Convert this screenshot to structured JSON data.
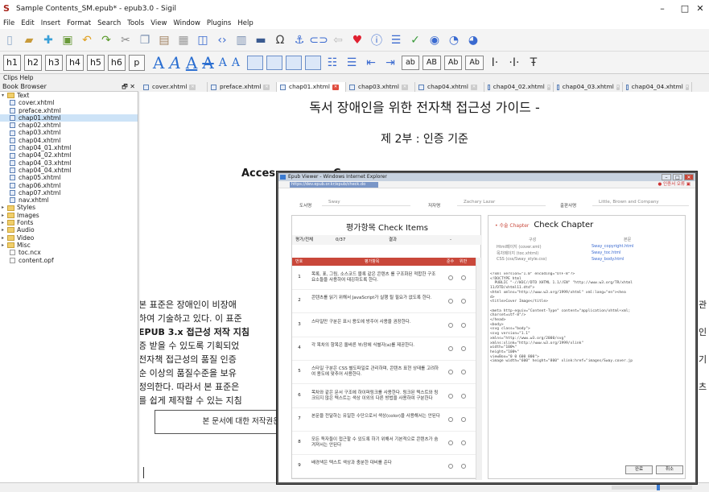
{
  "window": {
    "title": "Sample Contents_SM.epub* - epub3.0 - Sigil",
    "app_icon": "S",
    "minimize": "–",
    "maximize": "□",
    "close": "✕"
  },
  "menu": [
    "File",
    "Edit",
    "Insert",
    "Format",
    "Search",
    "Tools",
    "View",
    "Window",
    "Plugins",
    "Help"
  ],
  "toolbar2": {
    "headings": [
      "h1",
      "h2",
      "h3",
      "h4",
      "h5",
      "h6",
      "p"
    ],
    "a_sizes": [
      "A",
      "A",
      "A",
      "A",
      "A",
      "A"
    ],
    "case": [
      "ab",
      "AB",
      "Ab",
      "Ab"
    ]
  },
  "clips_label": "Clips Help",
  "book_browser": {
    "title": "Book Browser",
    "controls": "🗗 ✕",
    "items": [
      {
        "label": "Text",
        "type": "folder-open"
      },
      {
        "label": "cover.xhtml",
        "type": "file"
      },
      {
        "label": "preface.xhtml",
        "type": "file"
      },
      {
        "label": "chap01.xhtml",
        "type": "file",
        "selected": true
      },
      {
        "label": "chap02.xhtml",
        "type": "file"
      },
      {
        "label": "chap03.xhtml",
        "type": "file"
      },
      {
        "label": "chap04.xhtml",
        "type": "file"
      },
      {
        "label": "chap04_01.xhtml",
        "type": "file"
      },
      {
        "label": "chap04_02.xhtml",
        "type": "file"
      },
      {
        "label": "chap04_03.xhtml",
        "type": "file"
      },
      {
        "label": "chap04_04.xhtml",
        "type": "file"
      },
      {
        "label": "chap05.xhtml",
        "type": "file"
      },
      {
        "label": "chap06.xhtml",
        "type": "file"
      },
      {
        "label": "chap07.xhtml",
        "type": "file"
      },
      {
        "label": "nav.xhtml",
        "type": "file"
      },
      {
        "label": "Styles",
        "type": "folder"
      },
      {
        "label": "Images",
        "type": "folder"
      },
      {
        "label": "Fonts",
        "type": "folder"
      },
      {
        "label": "Audio",
        "type": "folder"
      },
      {
        "label": "Video",
        "type": "folder"
      },
      {
        "label": "Misc",
        "type": "folder"
      },
      {
        "label": "toc.ncx",
        "type": "doc"
      },
      {
        "label": "content.opf",
        "type": "doc"
      }
    ]
  },
  "tabs": [
    "cover.xhtml",
    "preface.xhtml",
    "chap01.xhtml",
    "chap03.xhtml",
    "chap04.xhtml",
    "chap04_02.xhtml",
    "chap04_03.xhtml",
    "chap04_04.xhtml"
  ],
  "editor": {
    "heading1": "독서 장애인을 위한 전자책 접근성 가이드 -",
    "heading2": "제 2부 : 인증 기준",
    "heading3": "Acces",
    "heading3_tail": "C",
    "body_lines": [
      "본 표준은 장애인이 비장애",
      "하여 기술하고 있다. 이 표준",
      "EPUB 3.x 접근성 저작 지침",
      "증 받을 수 있도록 기획되었",
      "전자책 접근성의 품질 인증",
      "순 이상의 품질수준을 보유",
      "정의한다. 따라서 본 표준은",
      "를 쉽게 제작할 수 있는 지침"
    ],
    "right_chars": [
      "관",
      "",
      "인",
      "",
      "기",
      "",
      "츠",
      ""
    ],
    "copyright_box": "본 문서에 대한 저작권은"
  },
  "popup": {
    "title": "Epub Viewer - Windows Internet Explorer",
    "url": "https://dev.epub.or.kr/epub/check.do",
    "security": "● 인증서 오류 ▣",
    "meta": [
      {
        "label": "도서명",
        "value": "Sway"
      },
      {
        "label": "저자명",
        "value": "Zachary Lazar"
      },
      {
        "label": "출판사명",
        "value": "Little, Brown and Company"
      }
    ],
    "check_title": "평가항목 Check Items",
    "score_label": "평가/전체",
    "score_value": "0/37",
    "result_label": "결과",
    "result_value": "-",
    "table_head": [
      "번호",
      "평가항목",
      "준수",
      "위반"
    ],
    "check_items": [
      {
        "n": "1",
        "t": "목록, 표, 그림, 소스코드 블록 같은 콘텐츠 를 구조화된 적합한 구조 요소들을 사용하여 태깅하도록 한다."
      },
      {
        "n": "2",
        "t": "콘텐츠를 읽기 위해서 JavaScript가 실행 될 필요가 없도록 한다."
      },
      {
        "n": "3",
        "t": "스타일만 구분은 표시 용도에 방주어 사용을 권장한다."
      },
      {
        "n": "4",
        "t": "각 목차의 항목은 올바른 부/장에 식별자(a)를 제공한다."
      },
      {
        "n": "5",
        "t": "스타일 구분은 CSS 별도파일로 관리하며, 콘텐츠 표현 상태를 고려하여 용도에 맞추어 사용한다."
      },
      {
        "n": "6",
        "t": "목차와 같은 문서 구조에 하이퍼링크를 사용한다. 링크된 텍스트와 링크되지 않은 텍스트는 색상 이외의 다른 방법을 사용하여 구분한다"
      },
      {
        "n": "7",
        "t": "본문을 전달하는 유일한 수단으로서 색상(color)을 사용해서는 안된다"
      },
      {
        "n": "8",
        "t": "모든 독자들이 접근할 수 있도록 하기 위해서 기본적으로 콘텐츠가 숨겨져서는 안된다"
      },
      {
        "n": "9",
        "t": "배경색은 텍스트 색상과 충분한 대비를 준다"
      }
    ],
    "chapter_label": "• 수술 Chapter",
    "chapter_title": "Check Chapter",
    "chap_cols": [
      "구성",
      "본문"
    ],
    "chap_rows": [
      {
        "a": "Html페이지 (cover.xml)",
        "b": "Sway_copyright.html"
      },
      {
        "a": "목차페이지 (toc.xhtml)",
        "b": "Sway_toc.html"
      },
      {
        "a": "CSS (css/Sway_style.css)",
        "b": "Sway_body.html"
      }
    ],
    "code": "<?xml version=\"1.0\" encoding=\"UTF-8\"?>\n<!DOCTYPE html\n  PUBLIC \"-//W3C//DTD XHTML 1.1//EN\" \"http://www.w3.org/TR/xhtml\n11/DTD/xhtml11.dtd\">\n<html xmlns=\"http://www.w3.org/1999/xhtml\" xml:lang=\"en\"><hea\nd>\n<title>Cover Image</title>\n\n<meta http-equiv=\"Content-Type\" content=\"application/xhtml+xml;\ncharset=utf-8\"/>\n</head>\n<body>\n<svg class=\"body\">\n<svg version=\"1.1\"\nxmlns=\"http://www.w3.org/2000/svg\"\nxmlns:xlink=\"http://www.w3.org/1999/xlink\"\nwidth=\"100%\"\nheight=\"100%\"\nviewBox=\"0 0 600 800\">\n<image width=\"600\" height=\"800\" xlink:href=\"images/Sway.cover.jp\ng\" transform=\"translate(0 0)\" />\n</svg>\n</div>\n</body>\n</html>",
    "ok_button": "완료",
    "cancel_button": "취소"
  }
}
